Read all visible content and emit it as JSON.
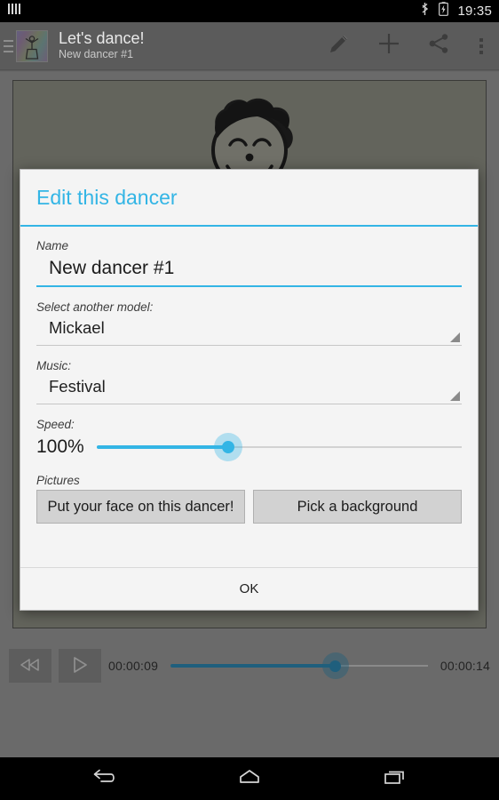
{
  "status_bar": {
    "notification_icon": "signal-bars-icon",
    "bluetooth_icon": "bluetooth-icon",
    "battery_icon": "battery-charging-icon",
    "clock": "19:35"
  },
  "action_bar": {
    "app_icon": "dancer-app-icon",
    "drawer_icon": "drawer-indicator-icon",
    "title": "Let's dance!",
    "subtitle": "New dancer #1",
    "actions": [
      {
        "name": "edit-action",
        "icon": "pencil-icon"
      },
      {
        "name": "add-action",
        "icon": "plus-icon"
      },
      {
        "name": "share-action",
        "icon": "share-icon"
      },
      {
        "name": "overflow-action",
        "icon": "overflow-menu-icon"
      }
    ]
  },
  "stage": {
    "background_color": "#63645c",
    "dancer_head_icon": "cartoon-face-icon",
    "dancer_shoes_icon": "red-shoes-icon"
  },
  "dialog": {
    "title": "Edit this dancer",
    "accent_color": "#33b5e5",
    "name": {
      "label": "Name",
      "value": "New dancer #1",
      "placeholder": "Name"
    },
    "model": {
      "label": "Select another model:",
      "value": "Mickael"
    },
    "music": {
      "label": "Music:",
      "value": "Festival"
    },
    "speed": {
      "label": "Speed:",
      "value": "100%",
      "percent": 36
    },
    "pictures": {
      "label": "Pictures",
      "face_button": "Put your face on this dancer!",
      "background_button": "Pick a background"
    },
    "ok_button": "OK"
  },
  "media_bar": {
    "rewind_icon": "rewind-icon",
    "play_icon": "play-icon",
    "current_time": "00:00:09",
    "total_time": "00:00:14",
    "progress_percent": 64
  },
  "nav_bar": {
    "back_icon": "back-icon",
    "home_icon": "home-icon",
    "recents_icon": "recents-icon"
  }
}
